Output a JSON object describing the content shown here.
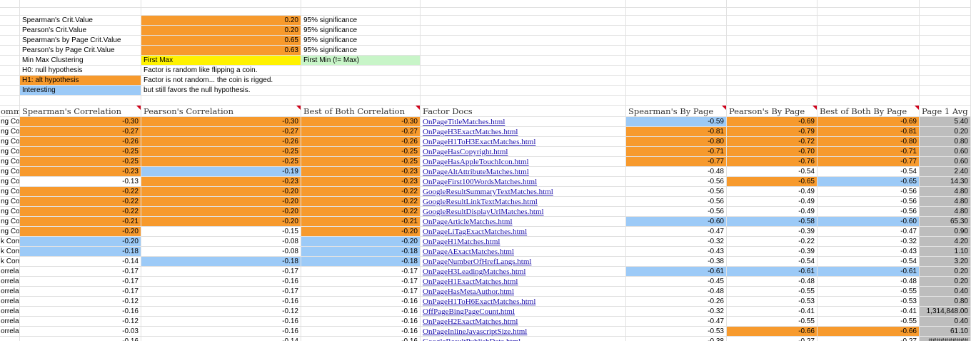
{
  "colors": {
    "orange": "#f79a2d",
    "blue": "#9ccaf7",
    "yellow": "#fff200",
    "green": "#c8f5c8",
    "gray": "#bdbdbd",
    "link": "#1a0dab"
  },
  "legend": [
    {
      "label": "Spearman's Crit.Value",
      "value": "0.20",
      "note": "95% significance",
      "label_fill": "",
      "value_fill": "orange",
      "note_fill": ""
    },
    {
      "label": "Pearson's Crit.Value",
      "value": "0.20",
      "note": "95% significance",
      "label_fill": "",
      "value_fill": "orange",
      "note_fill": ""
    },
    {
      "label": "Spearman's by Page Crit.Value",
      "value": "0.65",
      "note": "95% significance",
      "label_fill": "",
      "value_fill": "orange",
      "note_fill": ""
    },
    {
      "label": "Pearson's by Page Crit.Value",
      "value": "0.63",
      "note": "95% significance",
      "label_fill": "",
      "value_fill": "orange",
      "note_fill": ""
    },
    {
      "label": "Min Max Clustering",
      "value": "First Max",
      "note": "First Min (!= Max)",
      "label_fill": "",
      "value_fill": "yellow",
      "note_fill": "green"
    },
    {
      "label": "H0: null hypothesis",
      "value": "Factor is random like flipping a coin.",
      "note": "",
      "label_fill": "",
      "value_fill": "",
      "note_fill": ""
    },
    {
      "label": "H1: alt hypothesis",
      "value": "Factor is not random... the coin is rigged.",
      "note": "",
      "label_fill": "orange",
      "value_fill": "",
      "note_fill": ""
    },
    {
      "label": "Interesting",
      "value": "but still favors the null hypothesis.",
      "note": "",
      "label_fill": "blue",
      "value_fill": "",
      "note_fill": ""
    }
  ],
  "table": {
    "headers": [
      "omme",
      "Spearman's Correlation",
      "Pearson's Correlation",
      "Best of Both Correlation",
      "Factor Docs",
      "Spearman's By Page",
      "Pearson's By Page",
      "Best of Both By Page",
      "Page 1 Avg"
    ],
    "rows": [
      {
        "a": "ng Corr",
        "sp": "-0.30",
        "pe": "-0.30",
        "bb": "-0.30",
        "doc": "OnPageTitleMatches.html",
        "spp": "-0.59",
        "pep": "-0.69",
        "bbp": "-0.69",
        "avg": "5.40",
        "f": [
          "orange",
          "orange",
          "orange",
          "blue",
          "orange",
          "orange"
        ]
      },
      {
        "a": "ng Corr",
        "sp": "-0.27",
        "pe": "-0.27",
        "bb": "-0.27",
        "doc": "OnPageH3ExactMatches.html",
        "spp": "-0.81",
        "pep": "-0.79",
        "bbp": "-0.81",
        "avg": "0.20",
        "f": [
          "orange",
          "orange",
          "orange",
          "orange",
          "orange",
          "orange"
        ]
      },
      {
        "a": "ng Corr",
        "sp": "-0.26",
        "pe": "-0.26",
        "bb": "-0.26",
        "doc": "OnPageH1ToH3ExactMatches.html",
        "spp": "-0.80",
        "pep": "-0.72",
        "bbp": "-0.80",
        "avg": "0.80",
        "f": [
          "orange",
          "orange",
          "orange",
          "orange",
          "orange",
          "orange"
        ]
      },
      {
        "a": "ng Corr",
        "sp": "-0.25",
        "pe": "-0.25",
        "bb": "-0.25",
        "doc": "OnPageHasCopyright.html",
        "spp": "-0.71",
        "pep": "-0.70",
        "bbp": "-0.71",
        "avg": "0.60",
        "f": [
          "orange",
          "orange",
          "orange",
          "orange",
          "orange",
          "orange"
        ]
      },
      {
        "a": "ng Corr",
        "sp": "-0.25",
        "pe": "-0.25",
        "bb": "-0.25",
        "doc": "OnPageHasAppleTouchIcon.html",
        "spp": "-0.77",
        "pep": "-0.76",
        "bbp": "-0.77",
        "avg": "0.60",
        "f": [
          "orange",
          "orange",
          "orange",
          "orange",
          "orange",
          "orange"
        ]
      },
      {
        "a": "ng Corr",
        "sp": "-0.23",
        "pe": "-0.19",
        "bb": "-0.23",
        "doc": "OnPageAltAttributeMatches.html",
        "spp": "-0.48",
        "pep": "-0.54",
        "bbp": "-0.54",
        "avg": "2.40",
        "f": [
          "orange",
          "blue",
          "orange",
          "",
          "",
          ""
        ]
      },
      {
        "a": "ng Corr",
        "sp": "-0.13",
        "pe": "-0.23",
        "bb": "-0.23",
        "doc": "OnPageFirst100WordsMatches.html",
        "spp": "-0.56",
        "pep": "-0.65",
        "bbp": "-0.65",
        "avg": "14.30",
        "f": [
          "",
          "orange",
          "orange",
          "",
          "orange",
          "blue"
        ]
      },
      {
        "a": "ng Corr",
        "sp": "-0.22",
        "pe": "-0.20",
        "bb": "-0.22",
        "doc": "GoogleResultSummaryTextMatches.html",
        "spp": "-0.56",
        "pep": "-0.49",
        "bbp": "-0.56",
        "avg": "4.80",
        "f": [
          "orange",
          "orange",
          "orange",
          "",
          "",
          ""
        ]
      },
      {
        "a": "ng Corr",
        "sp": "-0.22",
        "pe": "-0.20",
        "bb": "-0.22",
        "doc": "GoogleResultLinkTextMatches.html",
        "spp": "-0.56",
        "pep": "-0.49",
        "bbp": "-0.56",
        "avg": "4.80",
        "f": [
          "orange",
          "orange",
          "orange",
          "",
          "",
          ""
        ]
      },
      {
        "a": "ng Corr",
        "sp": "-0.22",
        "pe": "-0.20",
        "bb": "-0.22",
        "doc": "GoogleResultDisplayUrlMatches.html",
        "spp": "-0.56",
        "pep": "-0.49",
        "bbp": "-0.56",
        "avg": "4.80",
        "f": [
          "orange",
          "orange",
          "orange",
          "",
          "",
          ""
        ]
      },
      {
        "a": "ng Corr",
        "sp": "-0.21",
        "pe": "-0.20",
        "bb": "-0.21",
        "doc": "OnPageArticleMatches.html",
        "spp": "-0.60",
        "pep": "-0.58",
        "bbp": "-0.60",
        "avg": "65.30",
        "f": [
          "orange",
          "orange",
          "orange",
          "blue",
          "blue",
          "blue"
        ]
      },
      {
        "a": "ng Corr",
        "sp": "-0.20",
        "pe": "-0.15",
        "bb": "-0.20",
        "doc": "OnPageLiTagExactMatches.html",
        "spp": "-0.47",
        "pep": "-0.39",
        "bbp": "-0.47",
        "avg": "0.90",
        "f": [
          "orange",
          "",
          "orange",
          "",
          "",
          ""
        ]
      },
      {
        "a": "k Corre",
        "sp": "-0.20",
        "pe": "-0.08",
        "bb": "-0.20",
        "doc": "OnPageH1Matches.html",
        "spp": "-0.32",
        "pep": "-0.22",
        "bbp": "-0.32",
        "avg": "4.20",
        "f": [
          "blue",
          "",
          "blue",
          "",
          "",
          ""
        ]
      },
      {
        "a": "k Corre",
        "sp": "-0.18",
        "pe": "-0.08",
        "bb": "-0.18",
        "doc": "OnPageAExactMatches.html",
        "spp": "-0.43",
        "pep": "-0.39",
        "bbp": "-0.43",
        "avg": "1.10",
        "f": [
          "blue",
          "",
          "blue",
          "",
          "",
          ""
        ]
      },
      {
        "a": "k Corre",
        "sp": "-0.14",
        "pe": "-0.18",
        "bb": "-0.18",
        "doc": "OnPageNumberOfHrefLangs.html",
        "spp": "-0.38",
        "pep": "-0.54",
        "bbp": "-0.54",
        "avg": "3.20",
        "f": [
          "",
          "blue",
          "blue",
          "",
          "",
          ""
        ]
      },
      {
        "a": "orrelat",
        "sp": "-0.17",
        "pe": "-0.17",
        "bb": "-0.17",
        "doc": "OnPageH3LeadingMatches.html",
        "spp": "-0.61",
        "pep": "-0.61",
        "bbp": "-0.61",
        "avg": "0.20",
        "f": [
          "",
          "",
          "",
          "blue",
          "blue",
          "blue"
        ]
      },
      {
        "a": "orrelat",
        "sp": "-0.17",
        "pe": "-0.16",
        "bb": "-0.17",
        "doc": "OnPageH1ExactMatches.html",
        "spp": "-0.45",
        "pep": "-0.48",
        "bbp": "-0.48",
        "avg": "0.20",
        "f": [
          "",
          "",
          "",
          "",
          "",
          ""
        ]
      },
      {
        "a": "orrelat",
        "sp": "-0.17",
        "pe": "-0.17",
        "bb": "-0.17",
        "doc": "OnPageHasMetaAuthor.html",
        "spp": "-0.48",
        "pep": "-0.55",
        "bbp": "-0.55",
        "avg": "0.40",
        "f": [
          "",
          "",
          "",
          "",
          "",
          ""
        ]
      },
      {
        "a": "orrelat",
        "sp": "-0.12",
        "pe": "-0.16",
        "bb": "-0.16",
        "doc": "OnPageH1ToH6ExactMatches.html",
        "spp": "-0.26",
        "pep": "-0.53",
        "bbp": "-0.53",
        "avg": "0.80",
        "f": [
          "",
          "",
          "",
          "",
          "",
          ""
        ]
      },
      {
        "a": "orrelat",
        "sp": "-0.16",
        "pe": "-0.12",
        "bb": "-0.16",
        "doc": "OffPageBingPageCount.html",
        "spp": "-0.32",
        "pep": "-0.41",
        "bbp": "-0.41",
        "avg": "1,314,848.00",
        "f": [
          "",
          "",
          "",
          "",
          "",
          ""
        ]
      },
      {
        "a": "orrelat",
        "sp": "-0.12",
        "pe": "-0.16",
        "bb": "-0.16",
        "doc": "OnPageH2ExactMatches.html",
        "spp": "-0.47",
        "pep": "-0.55",
        "bbp": "-0.55",
        "avg": "0.40",
        "f": [
          "",
          "",
          "",
          "",
          "",
          ""
        ]
      },
      {
        "a": "orrelat",
        "sp": "-0.03",
        "pe": "-0.16",
        "bb": "-0.16",
        "doc": "OnPageInlineJavascriptSize.html",
        "spp": "-0.53",
        "pep": "-0.66",
        "bbp": "-0.66",
        "avg": "61.10",
        "f": [
          "",
          "",
          "",
          "",
          "orange",
          "orange"
        ]
      },
      {
        "a": "",
        "sp": "-0.16",
        "pe": "-0.14",
        "bb": "-0.16",
        "doc": "GoogleResultPublishDate.html",
        "spp": "-0.38",
        "pep": "-0.27",
        "bbp": "-0.27",
        "avg": "##########",
        "f": [
          "",
          "",
          "",
          "",
          "",
          ""
        ]
      }
    ]
  }
}
